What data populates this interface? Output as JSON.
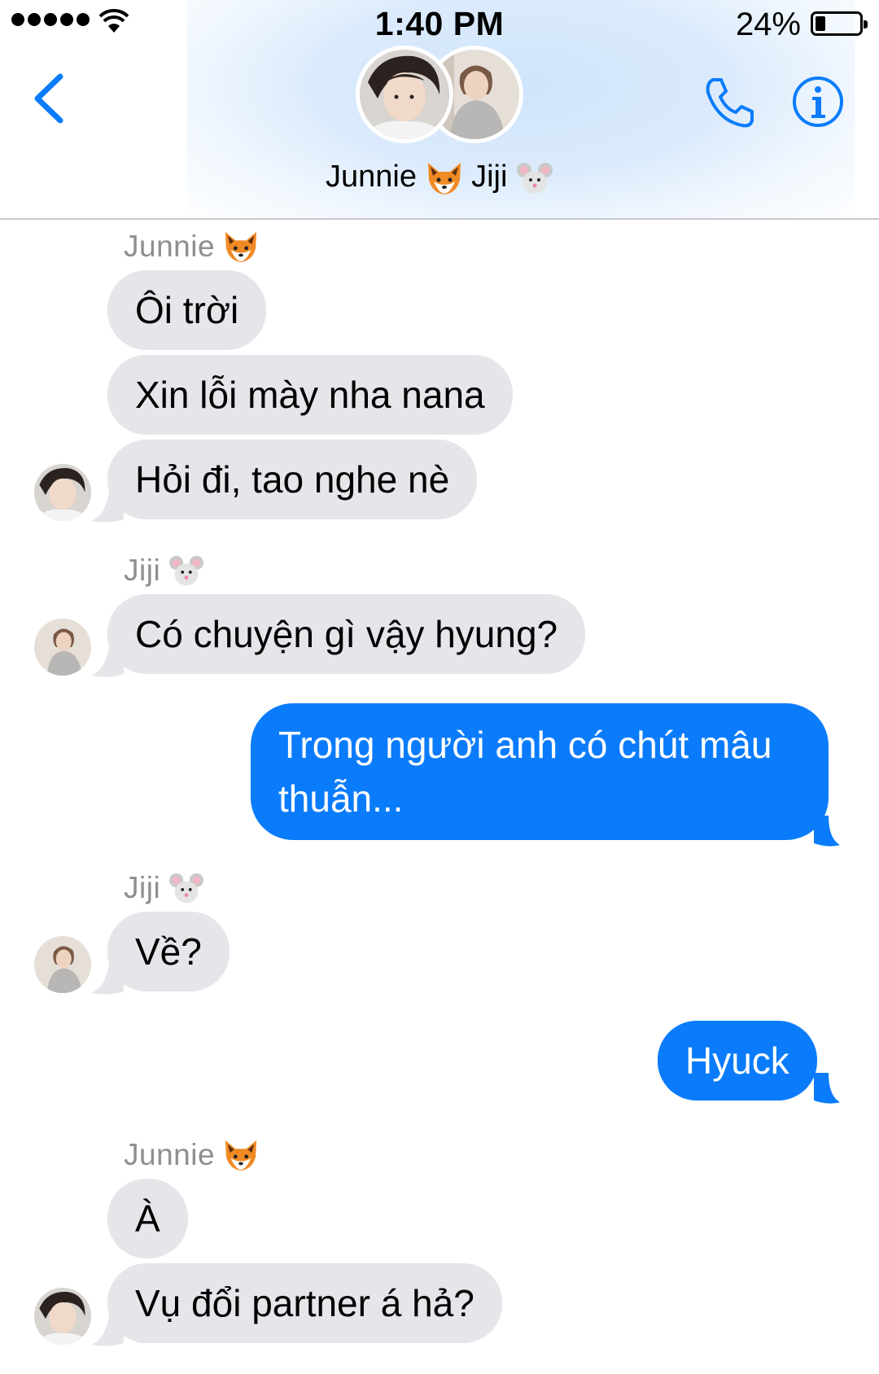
{
  "status_bar": {
    "time": "1:40 PM",
    "battery_percent": "24%",
    "battery_level": 0.24
  },
  "header": {
    "title_parts": [
      "Junnie",
      "Jiji"
    ],
    "title_emoji": [
      "fox-face-icon",
      "mouse-face-icon"
    ],
    "back_icon": "chevron-left-icon",
    "call_icon": "phone-icon",
    "info_icon": "info-icon",
    "accent_color": "#0a7cfb"
  },
  "messages": [
    {
      "type": "sender",
      "name": "Junnie",
      "emoji": "fox-face-icon"
    },
    {
      "type": "incoming",
      "text": "Ôi trời"
    },
    {
      "type": "incoming",
      "text": "Xin lỗi mày nha nana"
    },
    {
      "type": "incoming",
      "text": "Hỏi đi, tao nghe nè",
      "avatar": "junnie-avatar"
    },
    {
      "type": "sender",
      "name": "Jiji",
      "emoji": "mouse-face-icon"
    },
    {
      "type": "incoming",
      "text": "Có chuyện gì vậy hyung?",
      "avatar": "jiji-avatar"
    },
    {
      "type": "outgoing",
      "text": "Trong người anh có chút mâu thuẫn..."
    },
    {
      "type": "sender",
      "name": "Jiji",
      "emoji": "mouse-face-icon"
    },
    {
      "type": "incoming",
      "text": "Về?",
      "avatar": "jiji-avatar"
    },
    {
      "type": "outgoing",
      "text": "Hyuck"
    },
    {
      "type": "sender",
      "name": "Junnie",
      "emoji": "fox-face-icon"
    },
    {
      "type": "incoming",
      "text": "À"
    },
    {
      "type": "incoming",
      "text": "Vụ đổi partner á hả?",
      "avatar": "junnie-avatar"
    }
  ],
  "colors": {
    "incoming_bubble": "#e5e5ea",
    "outgoing_bubble": "#0a7cfb",
    "sender_label": "#8e8e93"
  }
}
